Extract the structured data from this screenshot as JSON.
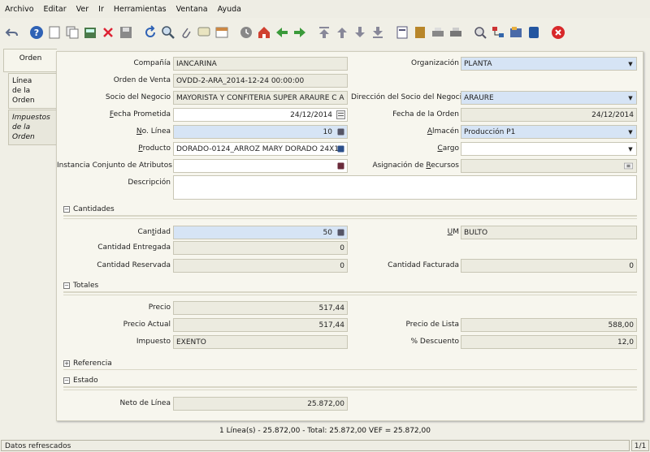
{
  "menu": [
    "Archivo",
    "Editar",
    "Ver",
    "Ir",
    "Herramientas",
    "Ventana",
    "Ayuda"
  ],
  "toolbar_icons": [
    "undo-icon",
    "help-icon",
    "new-icon",
    "copy-icon",
    "save-icon",
    "delete-icon",
    "save-disk-icon",
    "refresh-icon",
    "find-icon",
    "attachment-icon",
    "chat-icon",
    "calendar-icon",
    "history-icon",
    "home-icon",
    "back-icon",
    "forward-icon",
    "first-icon",
    "previous-icon",
    "next-icon",
    "last-icon",
    "report-icon",
    "archive-icon",
    "print-preview-icon",
    "print-icon",
    "zoom-across-icon",
    "workflow-icon",
    "product-info-icon",
    "process-icon",
    "close-window-icon"
  ],
  "tabs": [
    {
      "label": "Orden"
    },
    {
      "label_1": "Línea",
      "label_2": "de la Orden"
    },
    {
      "label_1": "Impuestos",
      "label_2": "de la Orden"
    }
  ],
  "fields": {
    "compania": {
      "label": "Compañía",
      "value": "IANCARINA"
    },
    "organizacion": {
      "label": "Organización",
      "value": "PLANTA"
    },
    "orden_venta": {
      "label": "Orden de Venta",
      "value": "OVDD-2-ARA_2014-12-24 00:00:00"
    },
    "socio": {
      "label": "Socio del Negocio",
      "value": "MAYORISTA Y CONFITERIA SUPER ARAURE  C A"
    },
    "direccion_socio": {
      "label": "Dirección del Socio del Negocio",
      "value": "ARAURE"
    },
    "fecha_prometida": {
      "label": "Fecha Prometida",
      "value": "24/12/2014"
    },
    "fecha_orden": {
      "label": "Fecha de la Orden",
      "value": "24/12/2014"
    },
    "no_linea": {
      "label": "No. Línea",
      "value": "10"
    },
    "almacen": {
      "label": "Almacén",
      "value": "Producción P1"
    },
    "producto": {
      "label": "Producto",
      "value": "DORADO-0124_ARROZ MARY DORADO 24X1"
    },
    "cargo": {
      "label": "Cargo",
      "value": ""
    },
    "instancia": {
      "label": "Instancia Conjunto de Atributos",
      "value": ""
    },
    "asignacion": {
      "label": "Asignación de Recursos",
      "value": ""
    },
    "descripcion": {
      "label": "Descripción",
      "value": ""
    },
    "cantidad": {
      "label": "Cantidad",
      "value": "50"
    },
    "um": {
      "label": "UM",
      "value": "BULTO"
    },
    "cantidad_entregada": {
      "label": "Cantidad Entregada",
      "value": "0"
    },
    "cantidad_reservada": {
      "label": "Cantidad Reservada",
      "value": "0"
    },
    "cantidad_facturada": {
      "label": "Cantidad Facturada",
      "value": "0"
    },
    "precio": {
      "label": "Precio",
      "value": "517,44"
    },
    "precio_actual": {
      "label": "Precio Actual",
      "value": "517,44"
    },
    "precio_lista": {
      "label": "Precio de Lista",
      "value": "588,00"
    },
    "impuesto": {
      "label": "Impuesto",
      "value": "EXENTO"
    },
    "descuento": {
      "label": "% Descuento",
      "value": "12,0"
    },
    "neto_linea": {
      "label": "Neto de Línea",
      "value": "25.872,00"
    }
  },
  "sections": {
    "cantidades": {
      "toggle": "−",
      "label": "Cantidades"
    },
    "totales": {
      "toggle": "−",
      "label": "Totales"
    },
    "referencia": {
      "toggle": "+",
      "label": "Referencia"
    },
    "estado": {
      "toggle": "−",
      "label": "Estado"
    }
  },
  "summary": "1 Línea(s) - 25.872,00 -  Total: 25.872,00  VEF = 25.872,00",
  "status": {
    "message": "Datos refrescados",
    "page": "1/1"
  },
  "colors": {
    "required_field": "#d6e4f5",
    "readonly_field": "#ecebe0",
    "editable_field": "#ffffff"
  }
}
